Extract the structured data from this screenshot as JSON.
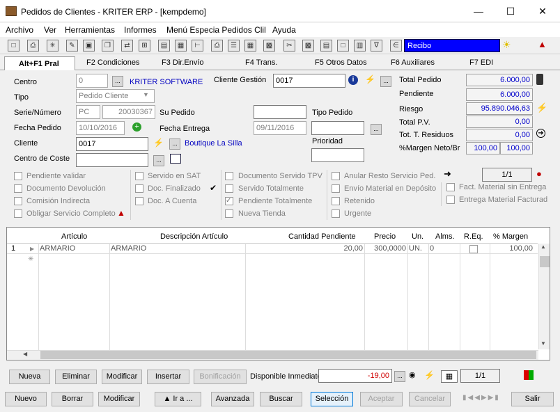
{
  "window": {
    "title": "Pedidos de Clientes - KRITER ERP - [kempdemo]"
  },
  "menu": [
    "Archivo",
    "Ver",
    "Herramientas",
    "Informes",
    "Menú Especia Pedidos Clil",
    "Ayuda"
  ],
  "toolbar": {
    "recibo": "Recibo"
  },
  "tabs": [
    "Alt+F1 Pral",
    "F2 Condiciones",
    "F3 Dir.Envío",
    "F4 Trans.",
    "F5 Otros Datos",
    "F6 Auxiliares",
    "F7 EDI"
  ],
  "form": {
    "centro_label": "Centro",
    "centro_value": "0",
    "centro_name": "KRITER SOFTWARE",
    "tipo_label": "Tipo",
    "tipo_value": "Pedido Cliente",
    "serie_label": "Serie/Número",
    "serie_value": "PC",
    "numero_value": "20030367",
    "su_pedido_label": "Su Pedido",
    "fecha_pedido_label": "Fecha Pedido",
    "fecha_pedido_value": "10/10/2016",
    "fecha_entrega_label": "Fecha Entrega",
    "fecha_entrega_value": "09/11/2016",
    "cliente_label": "Cliente",
    "cliente_value": "0017",
    "cliente_name": "Boutique La Silla",
    "centro_coste_label": "Centro de Coste",
    "cliente_gestion_label": "Cliente Gestión",
    "cliente_gestion_value": "0017",
    "tipo_pedido_label": "Tipo Pedido",
    "prioridad_label": "Prioridad"
  },
  "summary": {
    "total_pedido_label": "Total Pedido",
    "total_pedido": "6.000,00",
    "pendiente_label": "Pendiente",
    "pendiente": "6.000,00",
    "riesgo_label": "Riesgo",
    "riesgo": "95.890.046,63",
    "total_pv_label": "Total P.V.",
    "total_pv": "0,00",
    "tot_residuos_label": "Tot. T. Residuos",
    "tot_residuos": "0,00",
    "margen_label": "%Margen Neto/Br",
    "margen_neto": "100,00",
    "margen_bruto": "100,00"
  },
  "checks": {
    "pendiente_validar": "Pendiente validar",
    "documento_devolucion": "Documento Devolución",
    "comision_indirecta": "Comisión Indirecta",
    "obligar_servicio": "Obligar Servicio Completo",
    "servido_sat": "Servido en SAT",
    "doc_finalizado": "Doc. Finalizado",
    "doc_a_cuenta": "Doc. A Cuenta",
    "documento_servido_tpv": "Documento Servido TPV",
    "servido_totalmente": "Servido Totalmente",
    "pendiente_totalmente": "Pendiente Totalmente",
    "nueva_tienda": "Nueva Tienda",
    "anular_resto": "Anular Resto Servicio Ped.",
    "envio_material": "Envío Material en Depósito",
    "retenido": "Retenido",
    "urgente": "Urgente",
    "fact_material": "Fact. Material sin Entrega",
    "entrega_material": "Entrega Material Facturad",
    "page": "1/1"
  },
  "grid": {
    "headers": [
      "Artículo",
      "Descripción Artículo",
      "Cantidad Pendiente",
      "Precio",
      "Un.",
      "Alms.",
      "R.Eq.",
      "% Margen"
    ],
    "row": {
      "num": "1",
      "articulo": "ARMARIO",
      "descripcion": "ARMARIO",
      "cantidad": "20,00",
      "precio": "300,0000",
      "un": "UN.",
      "alms": "0",
      "margen": "100,00"
    }
  },
  "lines_bar": {
    "nueva": "Nueva",
    "eliminar": "Eliminar",
    "modificar": "Modificar",
    "insertar": "Insertar",
    "bonificacion": "Bonificación",
    "disponible_label": "Disponible Inmediato",
    "disponible": "-19,00",
    "page": "1/1"
  },
  "bottom_bar": {
    "nuevo": "Nuevo",
    "borrar": "Borrar",
    "modificar": "Modificar",
    "ira": "Ir a ...",
    "avanzada": "Avanzada",
    "buscar": "Buscar",
    "seleccion": "Selección",
    "aceptar": "Aceptar",
    "cancelar": "Cancelar",
    "salir": "Salir"
  }
}
